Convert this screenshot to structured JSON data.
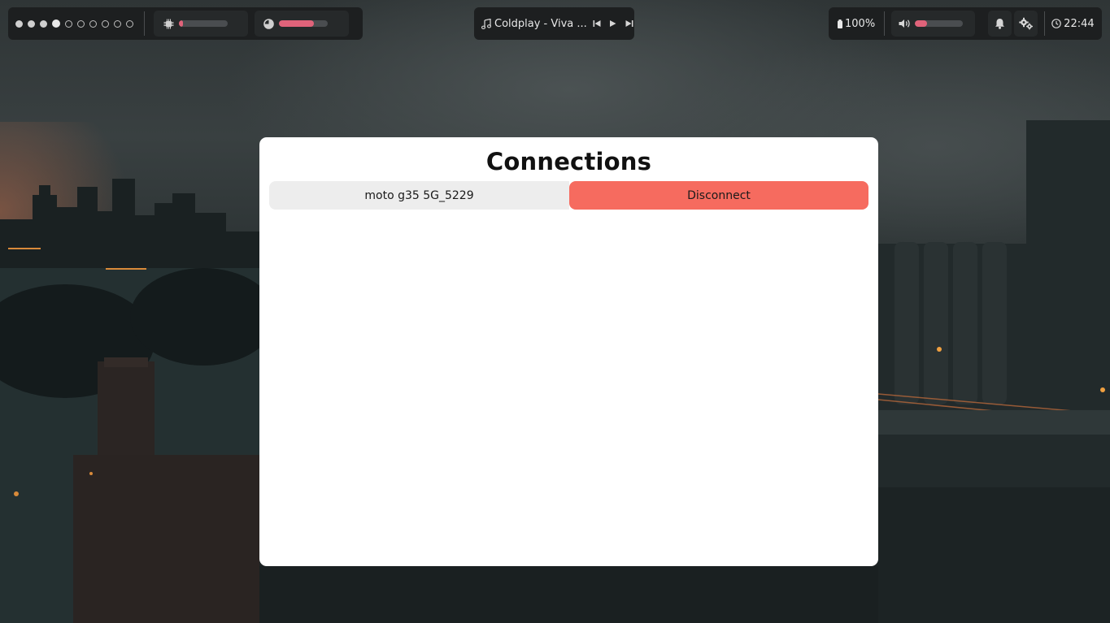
{
  "workspaces": [
    "occupied",
    "occupied",
    "occupied",
    "active",
    "empty",
    "empty",
    "empty",
    "empty",
    "empty",
    "empty"
  ],
  "system": {
    "cpu_usage_fraction": 0.08,
    "memory_usage_fraction": 0.72
  },
  "media": {
    "now_playing": "Coldplay - Viva ..."
  },
  "status": {
    "battery": "100%",
    "volume_fraction": 0.25,
    "clock": "22:44"
  },
  "dialog": {
    "title": "Connections",
    "connection": {
      "device_name": "moto g35 5G_5229",
      "action_label": "Disconnect"
    }
  },
  "colors": {
    "accent_meter": "#e0637a",
    "disconnect_button": "#f66b5f",
    "bar_background": "#1d1f20"
  },
  "icons": [
    "cpu-icon",
    "memory-icon",
    "music-note-icon",
    "skip-previous-icon",
    "play-icon",
    "skip-next-icon",
    "battery-icon",
    "volume-icon",
    "bell-icon",
    "settings-gears-icon",
    "clock-icon"
  ]
}
